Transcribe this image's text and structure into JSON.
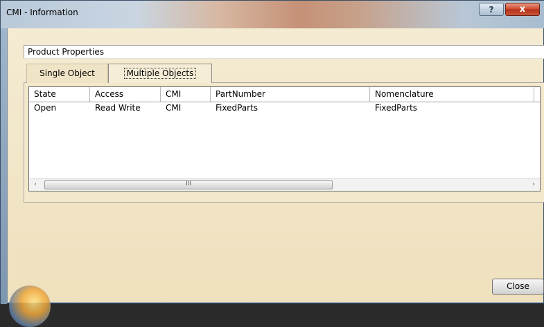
{
  "window": {
    "title": "CMI - Information",
    "help_label": "?",
    "close_glyph": "x"
  },
  "frame": {
    "label": "Product Properties"
  },
  "tabs": [
    {
      "label": "Single Object",
      "selected": false
    },
    {
      "label": "Multiple Objects",
      "selected": true
    }
  ],
  "table": {
    "columns": [
      "State",
      "Access",
      "CMI",
      "PartNumber",
      "Nomenclature"
    ],
    "rows": [
      [
        "Open",
        "Read Write",
        "CMI",
        "FixedParts",
        "FixedParts"
      ]
    ]
  },
  "scrollbar": {
    "left_arrow": "‹",
    "right_arrow": "›",
    "thumb_grip": "III"
  },
  "footer": {
    "close_label": "Close"
  }
}
